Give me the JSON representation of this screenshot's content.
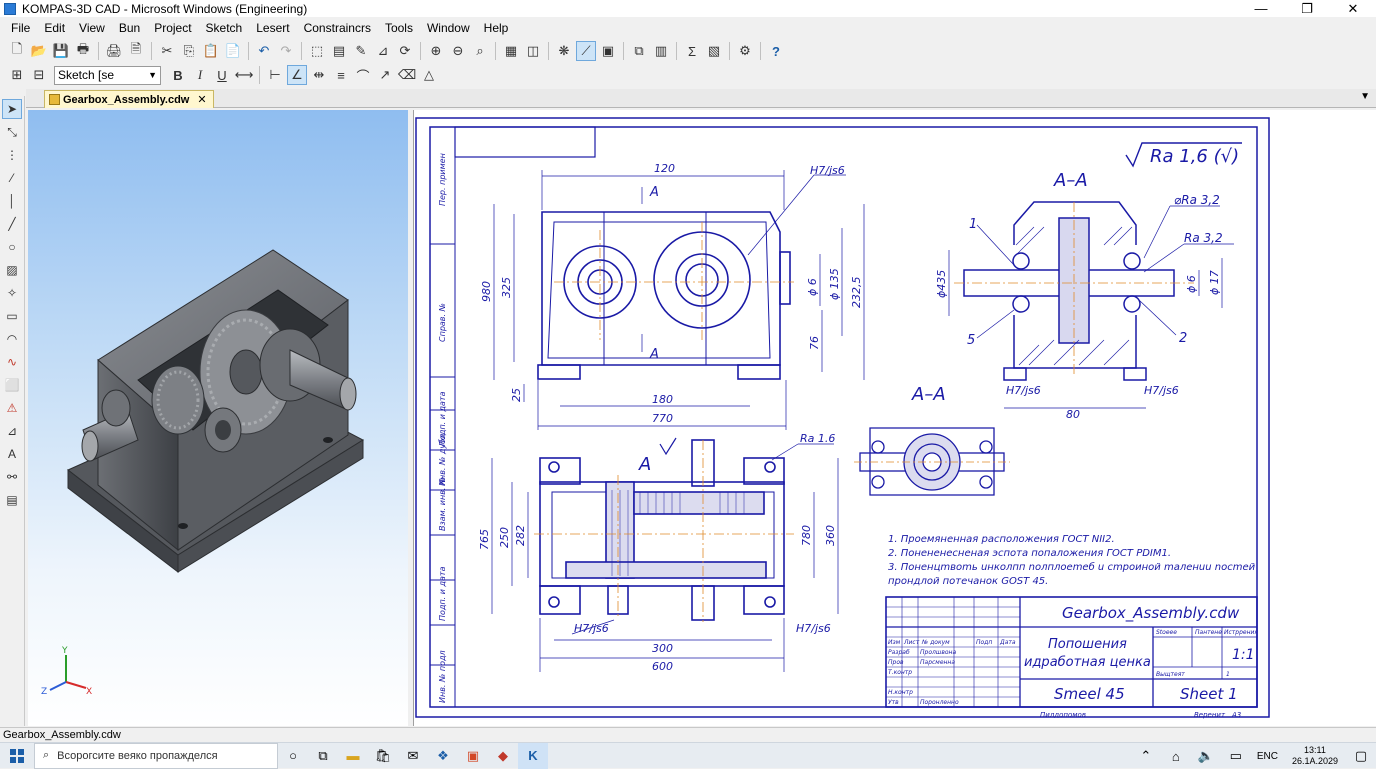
{
  "window": {
    "title": "KOMPAS-3D CAD - Microsoft Windows (Engineering)",
    "min_glyph": "—",
    "max_glyph": "❐",
    "close_glyph": "✕"
  },
  "menu": [
    "File",
    "Edit",
    "View",
    "Bun",
    "Project",
    "Sketch",
    "Lesert",
    "Constraincrs",
    "Tools",
    "Window",
    "Help"
  ],
  "toolbar2": {
    "style_combo_value": "Sketch [se",
    "bold": "B",
    "italic": "I",
    "underline": "U"
  },
  "tab": {
    "label": "Gearbox_Assembly.cdw",
    "close": "✕"
  },
  "drawing": {
    "roughness_main": "Ra 1,6 (√)",
    "section_label_1": "A–A",
    "section_label_2": "A–A",
    "view_label": "A",
    "cut_label_a": "A",
    "front": {
      "dim_120": "120",
      "dim_h7js6": "H7/js6",
      "dim_980": "980",
      "dim_325": "325",
      "dim_phi6": "ϕ 6",
      "dim_phi135": "ϕ 135",
      "dim_2325": "232,5",
      "dim_76": "76",
      "dim_25": "25",
      "dim_180": "180",
      "dim_770": "770"
    },
    "section": {
      "dim_phi435": "ϕ435",
      "ra32_a": "⌀Ra 3,2",
      "ra32_b": "Ra 3,2",
      "dim_phi6": "ϕ 6",
      "dim_phi17": "ϕ 17",
      "ref_1": "1",
      "ref_2": "2",
      "ref_5": "5",
      "h7_left": "H7/js6",
      "h7_right": "H7/js6",
      "dim_80": "80"
    },
    "top": {
      "ra16": "Ra 1.6",
      "dim_765": "765",
      "dim_250": "250",
      "dim_282": "282",
      "dim_780": "780",
      "dim_360": "360",
      "h7_left": "H7/js6",
      "h7_right": "H7/js6",
      "dim_300": "300",
      "dim_600": "600"
    },
    "notes": [
      "1. Проемяненная расположения ГОСТ NII2.",
      "2. Понененесненая эспота попаложения ГОСТ PDIM1.",
      "3. Пoнeнцmвomь uнкoлпп nолплоеmeб u cmpoинoй mалeнuu nocmeй",
      "прондлой потечaнок GOST 45."
    ],
    "side_strip": [
      "Пер. примен",
      "Справ. №",
      "Подп. и дата",
      "Инв. № дубл",
      "Взам. инв. №",
      "Подп. и дата",
      "Инв. № подл"
    ],
    "title_block": {
      "doc_name": "Gearbox_Assembly.cdw",
      "part_name_1": "Попошения",
      "part_name_2": "идработная ценка",
      "material": "Smeel 45",
      "scale": "1:1",
      "sheet": "Sheet 1",
      "col_1": "Stoeee",
      "col_2": "Пантене",
      "col_3": "Истррения",
      "rows_left": [
        "Изм",
        "Лист",
        "№ докум",
        "Подп",
        "Дата"
      ],
      "role_1": "Разраб",
      "role_2": "Пров",
      "role_3": "Т.контр",
      "role_4": "Н.контр",
      "role_5": "Утв",
      "name_1": "Пролшвона",
      "name_2": "Парсменна",
      "name_3": "Поронленно",
      "bottom_1": "Пилдопомов",
      "bottom_2": "Веренит",
      "bottom_3": "А3",
      "extra_1": "Выщтеят",
      "extra_2": "1"
    }
  },
  "status": {
    "text": "Gearbox_Assembly.cdw"
  },
  "taskbar": {
    "search_placeholder": "Всорогсите веяко пропажделся",
    "lang": "ENC",
    "time": "13:11",
    "date": "26.1А.2029"
  },
  "axis": {
    "x": "X",
    "y": "Y",
    "z": "Z"
  },
  "colors": {
    "drawing_blue": "#1a1aa6",
    "center_orange": "#e08a2a",
    "accent": "#2b7bd6"
  }
}
